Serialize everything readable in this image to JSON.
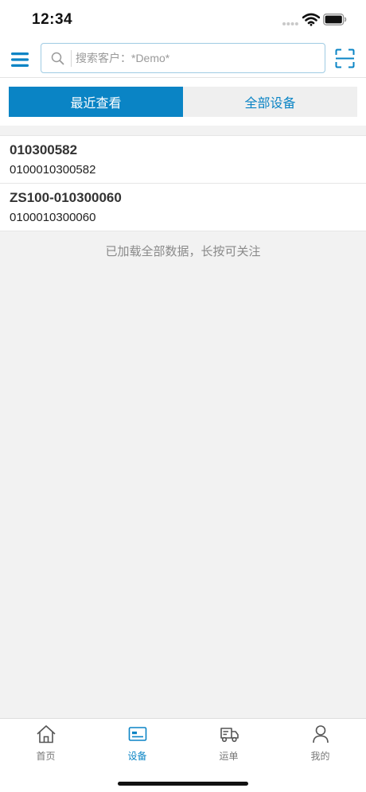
{
  "status_bar": {
    "time": "12:34",
    "icons": [
      "signal-dots-icon",
      "wifi-icon",
      "battery-icon"
    ]
  },
  "search": {
    "placeholder": "搜索客户：*Demo*",
    "value": "",
    "icons": [
      "menu-icon",
      "search-icon",
      "scan-icon"
    ]
  },
  "tabs": [
    {
      "label": "最近查看",
      "active": true
    },
    {
      "label": "全部设备",
      "active": false
    }
  ],
  "devices": [
    {
      "name": "010300582",
      "code": "0100010300582"
    },
    {
      "name": "ZS100-010300060",
      "code": "0100010300060"
    }
  ],
  "list_end_text": "已加载全部数据，长按可关注",
  "bottom_nav": [
    {
      "label": "首页",
      "icon": "home-icon",
      "active": false
    },
    {
      "label": "设备",
      "icon": "device-card-icon",
      "active": true
    },
    {
      "label": "运单",
      "icon": "truck-icon",
      "active": false
    },
    {
      "label": "我的",
      "icon": "user-icon",
      "active": false
    }
  ],
  "colors": {
    "accent": "#0a84c5",
    "inactive_tab_bg": "#efefef",
    "page_bg": "#f2f2f2",
    "nav_inactive": "#777777"
  }
}
